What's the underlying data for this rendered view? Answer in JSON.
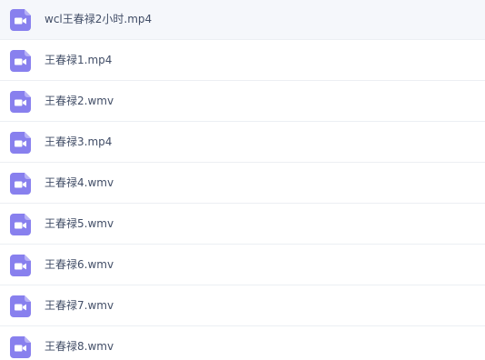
{
  "icon": "video-file-icon",
  "colors": {
    "icon_body": "#8880ee",
    "icon_glyph": "#ffffff",
    "text": "#424e67",
    "divider": "#eceff3"
  },
  "files": [
    {
      "name": "wcl王春禄2小时.mp4"
    },
    {
      "name": "王春禄1.mp4"
    },
    {
      "name": "王春禄2.wmv"
    },
    {
      "name": "王春禄3.mp4"
    },
    {
      "name": "王春禄4.wmv"
    },
    {
      "name": "王春禄5.wmv"
    },
    {
      "name": "王春禄6.wmv"
    },
    {
      "name": "王春禄7.wmv"
    },
    {
      "name": "王春禄8.wmv"
    }
  ]
}
